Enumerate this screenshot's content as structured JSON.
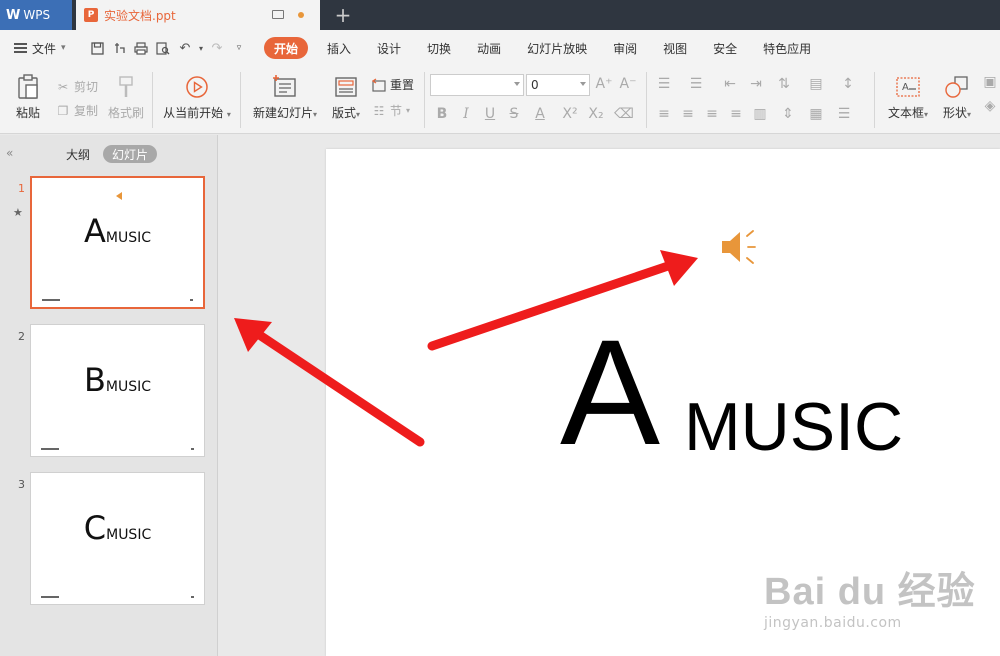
{
  "tabbar": {
    "app_label": "WPS",
    "doc_title": "实验文档.ppt",
    "new_tab_label": "+"
  },
  "menu": {
    "file_label": "文件",
    "items": [
      "开始",
      "插入",
      "设计",
      "切换",
      "动画",
      "幻灯片放映",
      "审阅",
      "视图",
      "安全",
      "特色应用"
    ],
    "active": "开始"
  },
  "ribbon": {
    "paste": "粘贴",
    "cut": "剪切",
    "copy": "复制",
    "format_painter": "格式刷",
    "from_current": "从当前开始",
    "new_slide": "新建幻灯片",
    "layout": "版式",
    "reset": "重置",
    "section": "节",
    "font_size": "0",
    "textbox": "文本框",
    "shape": "形状"
  },
  "leftpanel": {
    "tab_outline": "大纲",
    "tab_slides": "幻灯片",
    "slides": [
      {
        "num": "1",
        "letter": "A",
        "music": "MUSIC"
      },
      {
        "num": "2",
        "letter": "B",
        "music": "MUSIC"
      },
      {
        "num": "3",
        "letter": "C",
        "music": "MUSIC"
      }
    ]
  },
  "slide": {
    "letter": "A",
    "music": "MUSIC"
  },
  "watermark": {
    "main": "Bai du 经验",
    "sub": "jingyan.baidu.com"
  },
  "colors": {
    "accent": "#e8663a",
    "speaker": "#e8963a",
    "arrow": "#ee1c1c"
  }
}
